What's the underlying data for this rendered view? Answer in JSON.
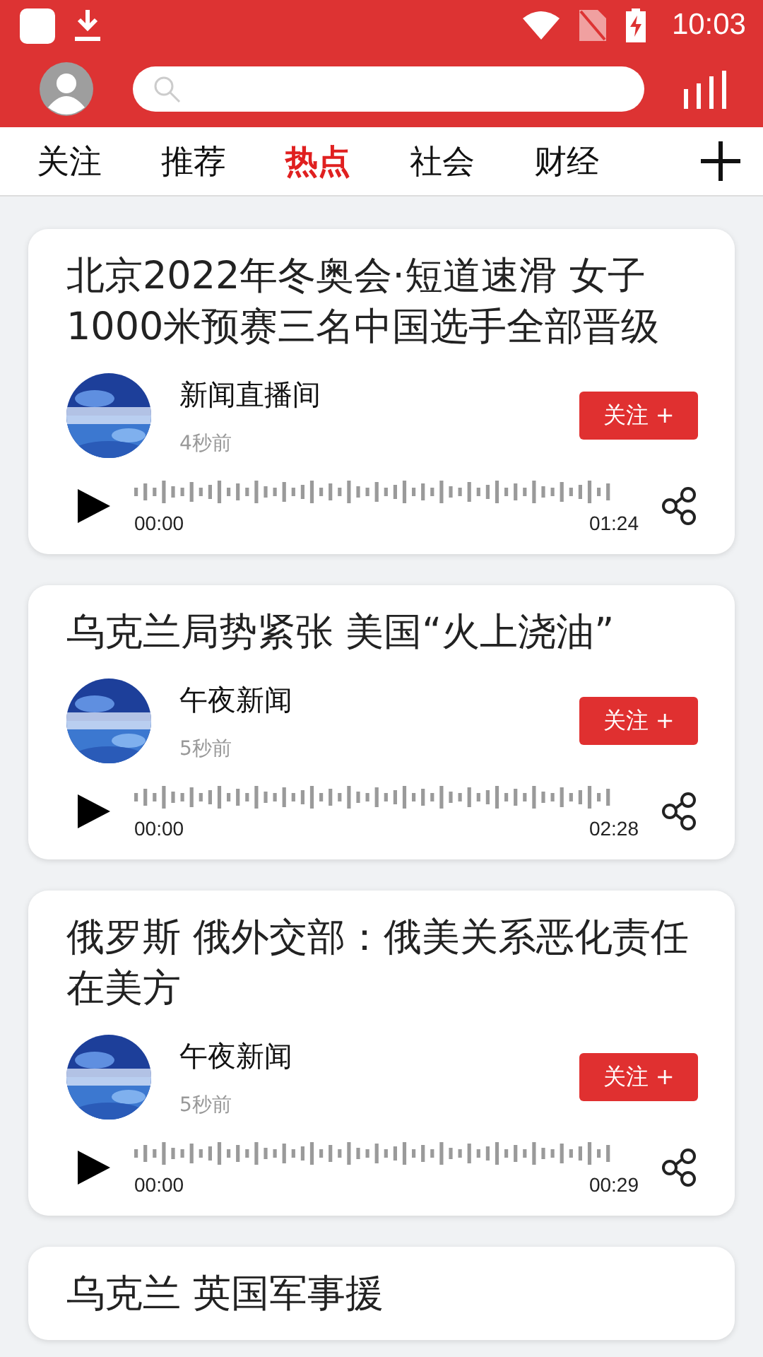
{
  "status_bar": {
    "time": "10:03"
  },
  "tabs": [
    {
      "label": "关注",
      "selected": false
    },
    {
      "label": "推荐",
      "selected": false
    },
    {
      "label": "热点",
      "selected": true
    },
    {
      "label": "社会",
      "selected": false
    },
    {
      "label": "财经",
      "selected": false
    }
  ],
  "cards": [
    {
      "title": "北京2022年冬奥会·短道速滑 女子1000米预赛三名中国选手全部晋级",
      "source": "新闻直播间",
      "time": "4秒前",
      "follow": "关注 +",
      "start": "00:00",
      "duration": "01:24"
    },
    {
      "title": "乌克兰局势紧张 美国“火上浇油”",
      "source": "午夜新闻",
      "time": "5秒前",
      "follow": "关注 +",
      "start": "00:00",
      "duration": "02:28"
    },
    {
      "title": "俄罗斯 俄外交部：俄美关系恶化责任在美方",
      "source": "午夜新闻",
      "time": "5秒前",
      "follow": "关注 +",
      "start": "00:00",
      "duration": "00:29"
    },
    {
      "title": "乌克兰 英国军事援"
    }
  ]
}
